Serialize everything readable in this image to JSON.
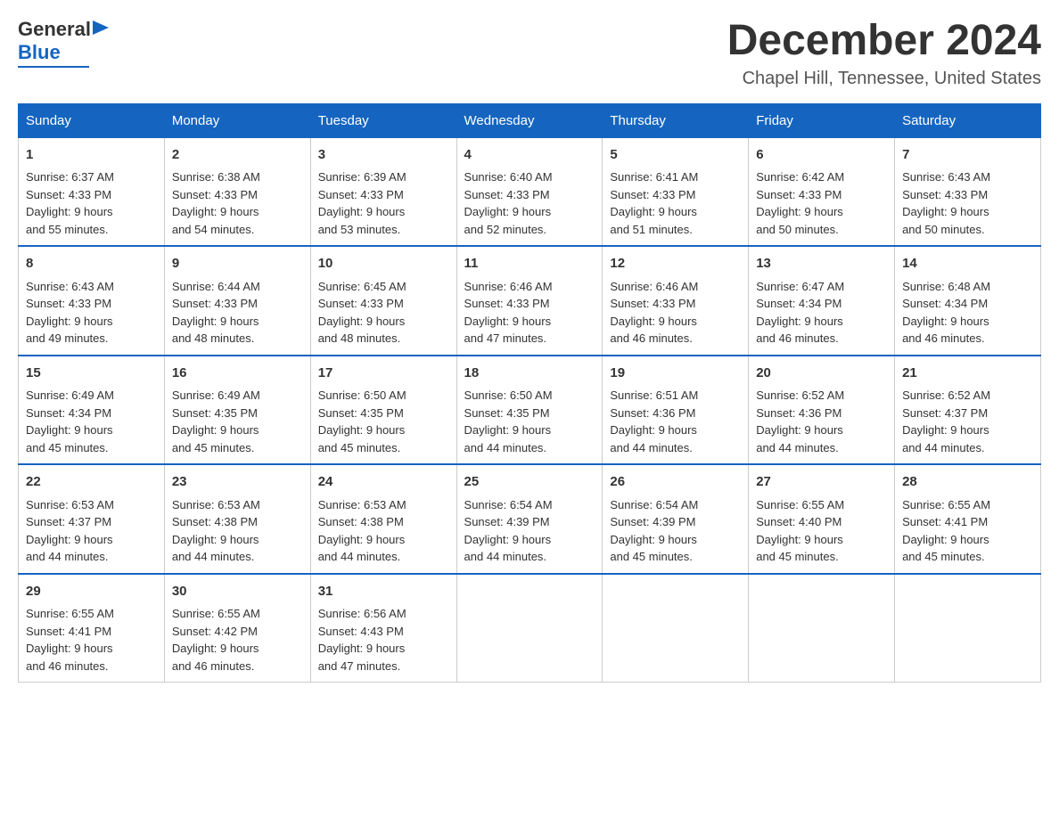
{
  "header": {
    "logo": {
      "general": "General",
      "blue": "Blue"
    },
    "month": "December 2024",
    "location": "Chapel Hill, Tennessee, United States"
  },
  "weekdays": [
    "Sunday",
    "Monday",
    "Tuesday",
    "Wednesday",
    "Thursday",
    "Friday",
    "Saturday"
  ],
  "weeks": [
    [
      {
        "day": "1",
        "sunrise": "6:37 AM",
        "sunset": "4:33 PM",
        "daylight": "9 hours and 55 minutes."
      },
      {
        "day": "2",
        "sunrise": "6:38 AM",
        "sunset": "4:33 PM",
        "daylight": "9 hours and 54 minutes."
      },
      {
        "day": "3",
        "sunrise": "6:39 AM",
        "sunset": "4:33 PM",
        "daylight": "9 hours and 53 minutes."
      },
      {
        "day": "4",
        "sunrise": "6:40 AM",
        "sunset": "4:33 PM",
        "daylight": "9 hours and 52 minutes."
      },
      {
        "day": "5",
        "sunrise": "6:41 AM",
        "sunset": "4:33 PM",
        "daylight": "9 hours and 51 minutes."
      },
      {
        "day": "6",
        "sunrise": "6:42 AM",
        "sunset": "4:33 PM",
        "daylight": "9 hours and 50 minutes."
      },
      {
        "day": "7",
        "sunrise": "6:43 AM",
        "sunset": "4:33 PM",
        "daylight": "9 hours and 50 minutes."
      }
    ],
    [
      {
        "day": "8",
        "sunrise": "6:43 AM",
        "sunset": "4:33 PM",
        "daylight": "9 hours and 49 minutes."
      },
      {
        "day": "9",
        "sunrise": "6:44 AM",
        "sunset": "4:33 PM",
        "daylight": "9 hours and 48 minutes."
      },
      {
        "day": "10",
        "sunrise": "6:45 AM",
        "sunset": "4:33 PM",
        "daylight": "9 hours and 48 minutes."
      },
      {
        "day": "11",
        "sunrise": "6:46 AM",
        "sunset": "4:33 PM",
        "daylight": "9 hours and 47 minutes."
      },
      {
        "day": "12",
        "sunrise": "6:46 AM",
        "sunset": "4:33 PM",
        "daylight": "9 hours and 46 minutes."
      },
      {
        "day": "13",
        "sunrise": "6:47 AM",
        "sunset": "4:34 PM",
        "daylight": "9 hours and 46 minutes."
      },
      {
        "day": "14",
        "sunrise": "6:48 AM",
        "sunset": "4:34 PM",
        "daylight": "9 hours and 46 minutes."
      }
    ],
    [
      {
        "day": "15",
        "sunrise": "6:49 AM",
        "sunset": "4:34 PM",
        "daylight": "9 hours and 45 minutes."
      },
      {
        "day": "16",
        "sunrise": "6:49 AM",
        "sunset": "4:35 PM",
        "daylight": "9 hours and 45 minutes."
      },
      {
        "day": "17",
        "sunrise": "6:50 AM",
        "sunset": "4:35 PM",
        "daylight": "9 hours and 45 minutes."
      },
      {
        "day": "18",
        "sunrise": "6:50 AM",
        "sunset": "4:35 PM",
        "daylight": "9 hours and 44 minutes."
      },
      {
        "day": "19",
        "sunrise": "6:51 AM",
        "sunset": "4:36 PM",
        "daylight": "9 hours and 44 minutes."
      },
      {
        "day": "20",
        "sunrise": "6:52 AM",
        "sunset": "4:36 PM",
        "daylight": "9 hours and 44 minutes."
      },
      {
        "day": "21",
        "sunrise": "6:52 AM",
        "sunset": "4:37 PM",
        "daylight": "9 hours and 44 minutes."
      }
    ],
    [
      {
        "day": "22",
        "sunrise": "6:53 AM",
        "sunset": "4:37 PM",
        "daylight": "9 hours and 44 minutes."
      },
      {
        "day": "23",
        "sunrise": "6:53 AM",
        "sunset": "4:38 PM",
        "daylight": "9 hours and 44 minutes."
      },
      {
        "day": "24",
        "sunrise": "6:53 AM",
        "sunset": "4:38 PM",
        "daylight": "9 hours and 44 minutes."
      },
      {
        "day": "25",
        "sunrise": "6:54 AM",
        "sunset": "4:39 PM",
        "daylight": "9 hours and 44 minutes."
      },
      {
        "day": "26",
        "sunrise": "6:54 AM",
        "sunset": "4:39 PM",
        "daylight": "9 hours and 45 minutes."
      },
      {
        "day": "27",
        "sunrise": "6:55 AM",
        "sunset": "4:40 PM",
        "daylight": "9 hours and 45 minutes."
      },
      {
        "day": "28",
        "sunrise": "6:55 AM",
        "sunset": "4:41 PM",
        "daylight": "9 hours and 45 minutes."
      }
    ],
    [
      {
        "day": "29",
        "sunrise": "6:55 AM",
        "sunset": "4:41 PM",
        "daylight": "9 hours and 46 minutes."
      },
      {
        "day": "30",
        "sunrise": "6:55 AM",
        "sunset": "4:42 PM",
        "daylight": "9 hours and 46 minutes."
      },
      {
        "day": "31",
        "sunrise": "6:56 AM",
        "sunset": "4:43 PM",
        "daylight": "9 hours and 47 minutes."
      },
      null,
      null,
      null,
      null
    ]
  ]
}
